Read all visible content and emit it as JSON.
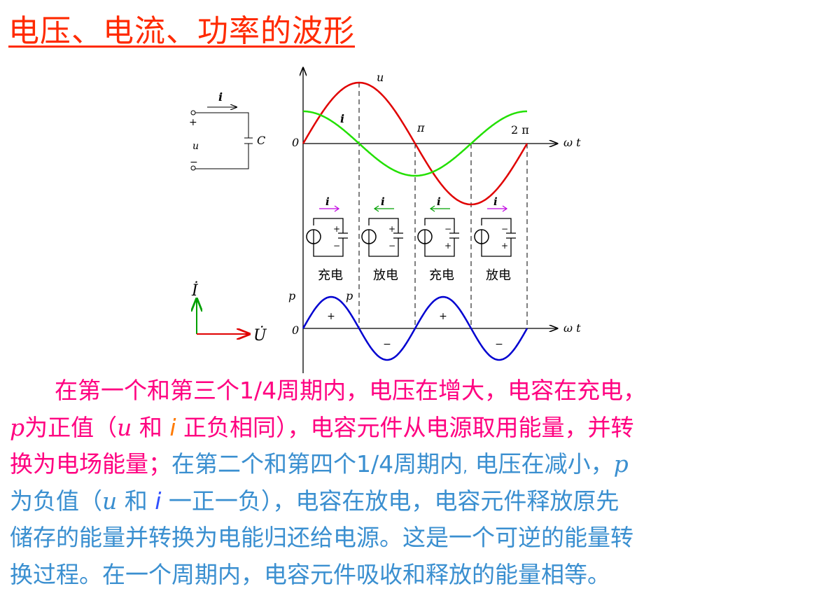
{
  "title": "电压、电流、功率的波形",
  "circuit": {
    "current": "i",
    "plus": "+",
    "minus": "−",
    "voltage": "u",
    "cap": "C"
  },
  "phasor": {
    "current": "İ",
    "voltage": "U̇"
  },
  "top_plot": {
    "origin": "0",
    "u": "u",
    "i": "i",
    "pi": "π",
    "two_pi": "2 π",
    "axis": "ω t",
    "colors": {
      "u": "#e00000",
      "i": "#22e000"
    }
  },
  "stages": [
    {
      "label": "充电",
      "i": "i",
      "arrow": "right",
      "top": "+",
      "bottom": "−"
    },
    {
      "label": "放电",
      "i": "i",
      "arrow": "left",
      "top": "+",
      "bottom": "−"
    },
    {
      "label": "充电",
      "i": "i",
      "arrow": "left",
      "top": "−",
      "bottom": "+"
    },
    {
      "label": "放电",
      "i": "i",
      "arrow": "right",
      "top": "−",
      "bottom": "+"
    }
  ],
  "bottom_plot": {
    "p_axis": "p",
    "p_curve": "p",
    "origin": "0",
    "axis": "ω t",
    "signs": [
      "+",
      "−",
      "+",
      "−"
    ],
    "color": "#0000d0"
  },
  "para": {
    "l1": "在第一个和第三个1/4周期内，电压在增大，电容在充电，",
    "l2a": "p",
    "l2b": "为正值（",
    "l2c": "u",
    "l2d": " 和 ",
    "l2e": "i",
    "l2f": " 正负相同），电容元件从电源取用能量，并转",
    "l3a": "换为电场能量；",
    "l3b": "在第二个和第四个1/4周期内",
    "l3c": ",",
    "l3d": " 电压在减小，",
    "l3e": "p",
    "l4a": "为负值（",
    "l4b": "u",
    "l4c": " 和 ",
    "l4d": "i",
    "l4e": " 一正一负），电容在放电，电容元件释放原先",
    "l5": "储存的能量并转换为电能归还给电源。这是一个可逆的能量转",
    "l6": "换过程。在一个周期内，电容元件吸收和释放的能量相等。"
  }
}
